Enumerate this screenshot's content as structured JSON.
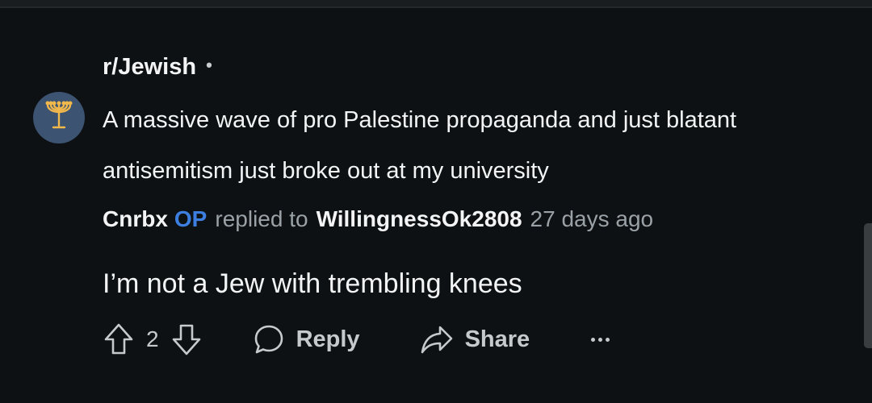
{
  "post": {
    "subreddit": "r/Jewish",
    "separator": "•",
    "title": "A massive wave of pro Palestine propaganda and just blatant antisemitism just broke out at my university",
    "avatar_icon": "menorah-icon"
  },
  "comment": {
    "author": "Cnrbx",
    "op_badge": "OP",
    "replied_to_text": "replied to",
    "reply_target": "WillingnessOk2808",
    "age": "27 days ago",
    "body": "I’m not a Jew with trembling knees"
  },
  "actions": {
    "vote_count": "2",
    "reply_label": "Reply",
    "share_label": "Share"
  },
  "colors": {
    "background": "#0e1113",
    "avatar_bg": "#3c5372",
    "menorah": "#f2b84b",
    "op_blue": "#3d7fe0",
    "muted_text": "#9aa2a7"
  }
}
